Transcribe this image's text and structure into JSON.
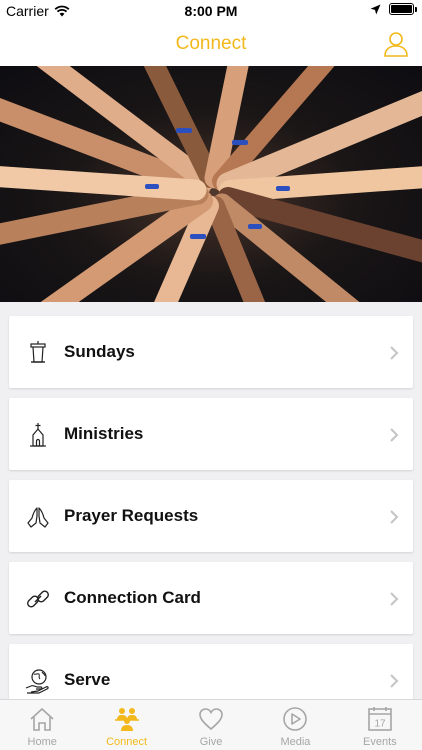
{
  "status": {
    "carrier": "Carrier",
    "time": "8:00 PM"
  },
  "header": {
    "title": "Connect"
  },
  "items": [
    {
      "label": "Sundays",
      "icon": "pulpit-icon"
    },
    {
      "label": "Ministries",
      "icon": "church-icon"
    },
    {
      "label": "Prayer Requests",
      "icon": "praying-hands-icon"
    },
    {
      "label": "Connection Card",
      "icon": "link-icon"
    },
    {
      "label": "Serve",
      "icon": "serve-globe-icon"
    }
  ],
  "tabs": [
    {
      "label": "Home",
      "icon": "home-icon"
    },
    {
      "label": "Connect",
      "icon": "people-icon",
      "active": true
    },
    {
      "label": "Give",
      "icon": "heart-icon"
    },
    {
      "label": "Media",
      "icon": "play-icon"
    },
    {
      "label": "Events",
      "icon": "calendar-icon",
      "day": "17"
    }
  ],
  "colors": {
    "accent": "#f2b81c",
    "inactive": "#a6a6a6"
  }
}
